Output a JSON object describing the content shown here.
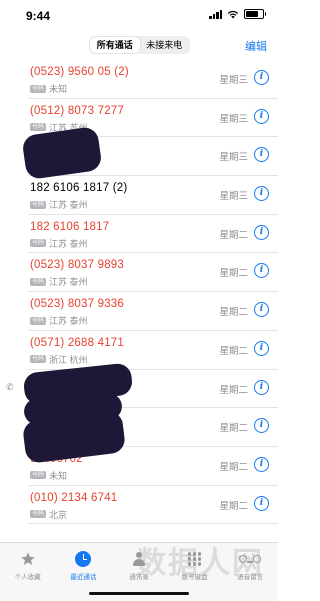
{
  "status_bar": {
    "time": "9:44"
  },
  "nav": {
    "segments": [
      "所有通话",
      "未接来电"
    ],
    "edit_label": "编辑"
  },
  "calls": [
    {
      "number": "(0523) 9560 05 (2)",
      "tag": "号码",
      "location": "未知",
      "day": "星期三",
      "missed": true
    },
    {
      "number": "(0512) 8073 7277",
      "tag": "号码",
      "location": "江苏 苏州",
      "day": "星期三",
      "missed": true
    },
    {
      "number": "",
      "tag": "",
      "location": "",
      "day": "星期三",
      "missed": false
    },
    {
      "number": "182 6106 1817 (2)",
      "tag": "号码",
      "location": "江苏 泰州",
      "day": "星期三",
      "missed": false
    },
    {
      "number": "182 6106 1817",
      "tag": "号码",
      "location": "江苏 泰州",
      "day": "星期二",
      "missed": true
    },
    {
      "number": "(0523) 8037 9893",
      "tag": "号码",
      "location": "江苏 泰州",
      "day": "星期二",
      "missed": true
    },
    {
      "number": "(0523) 8037 9336",
      "tag": "号码",
      "location": "江苏 泰州",
      "day": "星期二",
      "missed": true
    },
    {
      "number": "(0571) 2688 4171",
      "tag": "号码",
      "location": "浙江 杭州",
      "day": "星期二",
      "missed": true
    },
    {
      "number": "",
      "tag": "",
      "location": "",
      "day": "星期二",
      "missed": false
    },
    {
      "number": "",
      "tag": "",
      "location": "",
      "day": "星期二",
      "missed": false
    },
    {
      "number": "95406702",
      "tag": "号码",
      "location": "未知",
      "day": "星期二",
      "missed": true
    },
    {
      "number": "(010) 2134 6741",
      "tag": "号码",
      "location": "北京",
      "day": "星期二",
      "missed": true
    }
  ],
  "tabs": [
    {
      "label": "个人收藏",
      "icon": "star-icon"
    },
    {
      "label": "最近通话",
      "icon": "clock-icon"
    },
    {
      "label": "通讯录",
      "icon": "person-icon"
    },
    {
      "label": "拨号键盘",
      "icon": "keypad-icon"
    },
    {
      "label": "语音留言",
      "icon": "voicemail-icon"
    }
  ],
  "watermark": "数据人网",
  "colors": {
    "accent": "#1478f0",
    "missed": "#e8412f"
  }
}
